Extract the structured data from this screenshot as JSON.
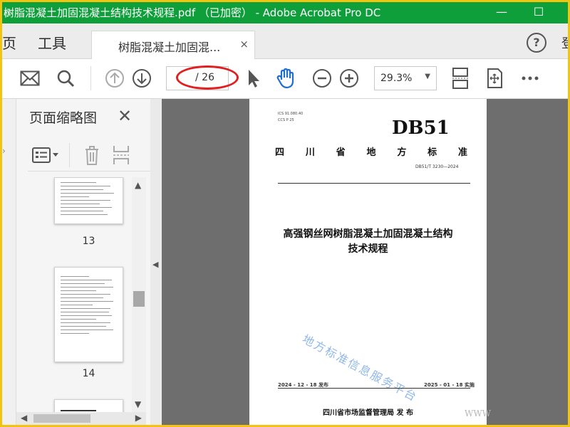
{
  "window": {
    "title": "树脂混凝土加固混凝土结构技术规程.pdf （已加密） - Adobe Acrobat Pro DC",
    "controls": {
      "minimize": "—",
      "maximize": "☐"
    }
  },
  "tabs": {
    "home": "页",
    "tools": "工具",
    "document": "树脂混凝土加固混...",
    "close": "×",
    "help": "?",
    "sign_in": "登"
  },
  "toolbar": {
    "page_current": "",
    "page_total": "/ 26",
    "zoom": "29.3%"
  },
  "thumbnails_panel": {
    "title": "页面缩略图",
    "close": "✕",
    "pages": [
      "13",
      "14"
    ]
  },
  "page": {
    "ics": "ICS  91.080.40",
    "ccs": "CCS  P 25",
    "brand": "DB51",
    "standard_chars": [
      "四",
      "川",
      "省",
      "地",
      "方",
      "标",
      "准"
    ],
    "code": "DB51/T 3230—2024",
    "title_line1": "高强钢丝网树脂混凝土加固混凝土结构",
    "title_line2": "技术规程",
    "watermark": "地方标准信息服务平台",
    "publish_date": "2024 - 12 - 18 发布",
    "effective_date": "2025 - 01 - 18 实施",
    "issuer": "四川省市场监督管理局    发 布"
  },
  "overlay": {
    "url_watermark": "WWW"
  },
  "colors": {
    "titlebar": "#0e9f3a",
    "highlight": "#e02020",
    "hand_tool": "#1f6fd1",
    "outer_border": "#f1c40f"
  }
}
